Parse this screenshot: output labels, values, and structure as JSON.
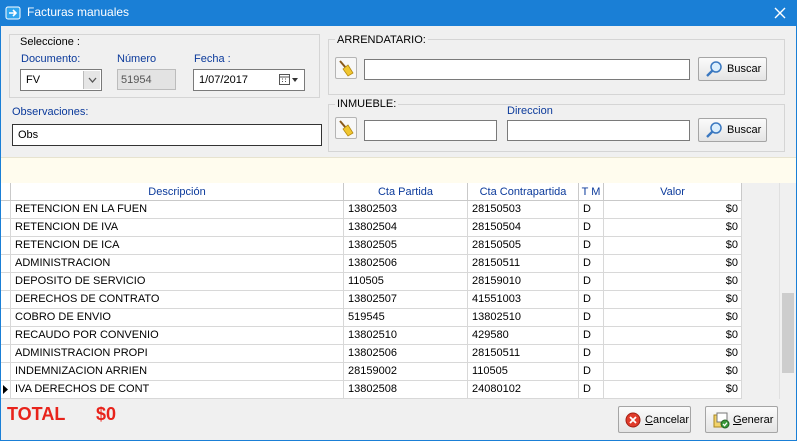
{
  "window": {
    "title": "Facturas manuales"
  },
  "seleccione": {
    "group_label": "Seleccione :",
    "documento_label": "Documento:",
    "documento_value": "FV",
    "numero_label": "Número",
    "numero_value": "51954",
    "fecha_label": "Fecha :",
    "fecha_value": "1/07/2017"
  },
  "observaciones": {
    "label": "Observaciones:",
    "value": "Obs"
  },
  "arrendatario": {
    "label": "ARRENDATARIO:",
    "value": "",
    "search_button": "Buscar"
  },
  "inmueble": {
    "label": "INMUEBLE:",
    "direccion_label": "Direccion",
    "value": "",
    "direccion_value": "",
    "search_button": "Buscar"
  },
  "grid": {
    "columns": [
      "Descripción",
      "Cta Partida",
      "Cta Contrapartida",
      "T M",
      "Valor"
    ],
    "rows": [
      [
        "RETENCION EN LA FUEN",
        "13802503",
        "28150503",
        "D",
        "$0"
      ],
      [
        "RETENCION DE IVA",
        "13802504",
        "28150504",
        "D",
        "$0"
      ],
      [
        "RETENCION DE ICA",
        "13802505",
        "28150505",
        "D",
        "$0"
      ],
      [
        "ADMINISTRACION",
        "13802506",
        "28150511",
        "D",
        "$0"
      ],
      [
        "DEPOSITO DE SERVICIO",
        "110505",
        "28159010",
        "D",
        "$0"
      ],
      [
        "DERECHOS DE CONTRATO",
        "13802507",
        "41551003",
        "D",
        "$0"
      ],
      [
        "COBRO DE ENVIO",
        "519545",
        "13802510",
        "D",
        "$0"
      ],
      [
        "RECAUDO POR CONVENIO",
        "13802510",
        "429580",
        "D",
        "$0"
      ],
      [
        "ADMINISTRACION PROPI",
        "13802506",
        "28150511",
        "D",
        "$0"
      ],
      [
        "INDEMNIZACION ARRIEN",
        "28159002",
        "110505",
        "D",
        "$0"
      ],
      [
        "IVA DERECHOS DE CONT",
        "13802508",
        "24080102",
        "D",
        "$0"
      ]
    ]
  },
  "footer": {
    "total_label": "TOTAL",
    "total_value": "$0",
    "cancelar_prefix": "C",
    "cancelar_rest": "ancelar",
    "generar_prefix": "G",
    "generar_rest": "enerar"
  },
  "colors": {
    "titlebar": "#1a7fd6",
    "total": "#e8231b",
    "label_blue": "#0b3a9b"
  },
  "icons": [
    "app-icon",
    "close-icon",
    "dropdown-arrow-icon",
    "calendar-icon",
    "broom-icon",
    "magnifier-icon",
    "cancel-icon",
    "generate-icon",
    "row-pointer-icon"
  ]
}
